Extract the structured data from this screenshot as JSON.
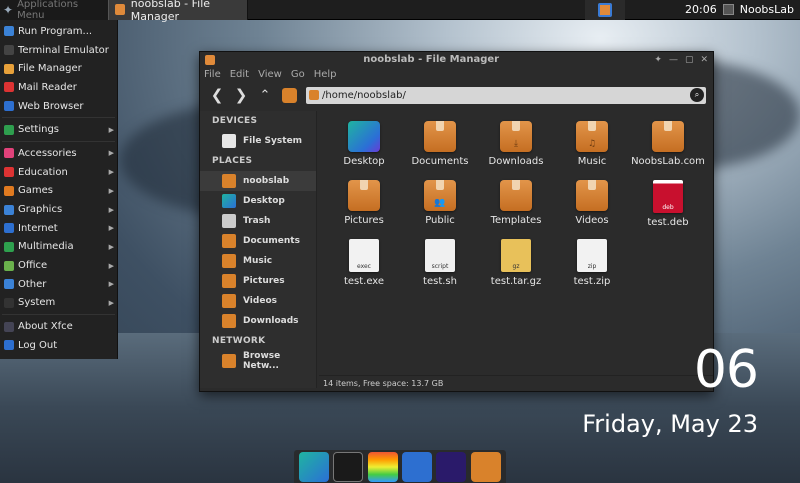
{
  "panel": {
    "app_menu": "Applications Menu",
    "task_title": "noobslab - File Manager",
    "time": "20:06",
    "user": "NoobsLab"
  },
  "menu": {
    "items": [
      {
        "label": "Run Program...",
        "icon": "run-icon",
        "color": "#3b82d6"
      },
      {
        "label": "Terminal Emulator",
        "icon": "terminal-icon",
        "color": "#444"
      },
      {
        "label": "File Manager",
        "icon": "file-manager-icon",
        "color": "#e8a13a"
      },
      {
        "label": "Mail Reader",
        "icon": "mail-icon",
        "color": "#d33"
      },
      {
        "label": "Web Browser",
        "icon": "browser-icon",
        "color": "#2d6fd0"
      },
      {
        "label": "Settings",
        "icon": "settings-icon",
        "color": "#2e9e4e"
      },
      {
        "label": "Accessories",
        "icon": "accessories-icon",
        "color": "#e0427a"
      },
      {
        "label": "Education",
        "icon": "education-icon",
        "color": "#d33"
      },
      {
        "label": "Games",
        "icon": "games-icon",
        "color": "#e07a20"
      },
      {
        "label": "Graphics",
        "icon": "graphics-icon",
        "color": "#3b82d6"
      },
      {
        "label": "Internet",
        "icon": "internet-icon",
        "color": "#2d6fd0"
      },
      {
        "label": "Multimedia",
        "icon": "multimedia-icon",
        "color": "#2ea04e"
      },
      {
        "label": "Office",
        "icon": "office-icon",
        "color": "#6ab04c"
      },
      {
        "label": "Other",
        "icon": "other-icon",
        "color": "#3b82d6"
      },
      {
        "label": "System",
        "icon": "system-icon",
        "color": "#333"
      },
      {
        "label": "About Xfce",
        "icon": "about-icon",
        "color": "#445"
      },
      {
        "label": "Log Out",
        "icon": "logout-icon",
        "color": "#2d6fd0"
      }
    ]
  },
  "window": {
    "title": "noobslab - File Manager",
    "menubar": [
      "File",
      "Edit",
      "View",
      "Go",
      "Help"
    ],
    "path": "/home/noobslab/",
    "status": "14 items, Free space: 13.7 GB",
    "sidebar": {
      "devices_header": "DEVICES",
      "devices": [
        "File System"
      ],
      "places_header": "PLACES",
      "places": [
        "noobslab",
        "Desktop",
        "Trash",
        "Documents",
        "Music",
        "Pictures",
        "Videos",
        "Downloads"
      ],
      "network_header": "NETWORK",
      "network": [
        "Browse Netw..."
      ]
    },
    "files": [
      {
        "name": "Desktop",
        "kind": "desktop"
      },
      {
        "name": "Documents",
        "kind": "folder"
      },
      {
        "name": "Downloads",
        "kind": "folder",
        "glyph": "⤓"
      },
      {
        "name": "Music",
        "kind": "folder",
        "glyph": "♫"
      },
      {
        "name": "NoobsLab.com",
        "kind": "folder"
      },
      {
        "name": "Pictures",
        "kind": "folder"
      },
      {
        "name": "Public",
        "kind": "folder",
        "glyph": "👥"
      },
      {
        "name": "Templates",
        "kind": "folder"
      },
      {
        "name": "Videos",
        "kind": "folder"
      },
      {
        "name": "test.deb",
        "kind": "deb",
        "tag": "deb"
      },
      {
        "name": "test.exe",
        "kind": "exe",
        "tag": "exec"
      },
      {
        "name": "test.sh",
        "kind": "sh",
        "tag": "script"
      },
      {
        "name": "test.tar.gz",
        "kind": "gz",
        "tag": "gz"
      },
      {
        "name": "test.zip",
        "kind": "zip",
        "tag": "zip"
      }
    ]
  },
  "desktop": {
    "time_fragment": "06",
    "date": "Friday, May 23"
  },
  "dock": [
    "desktop-app-icon",
    "terminal-icon",
    "notes-icon",
    "settings-icon",
    "search-icon",
    "file-manager-icon"
  ]
}
